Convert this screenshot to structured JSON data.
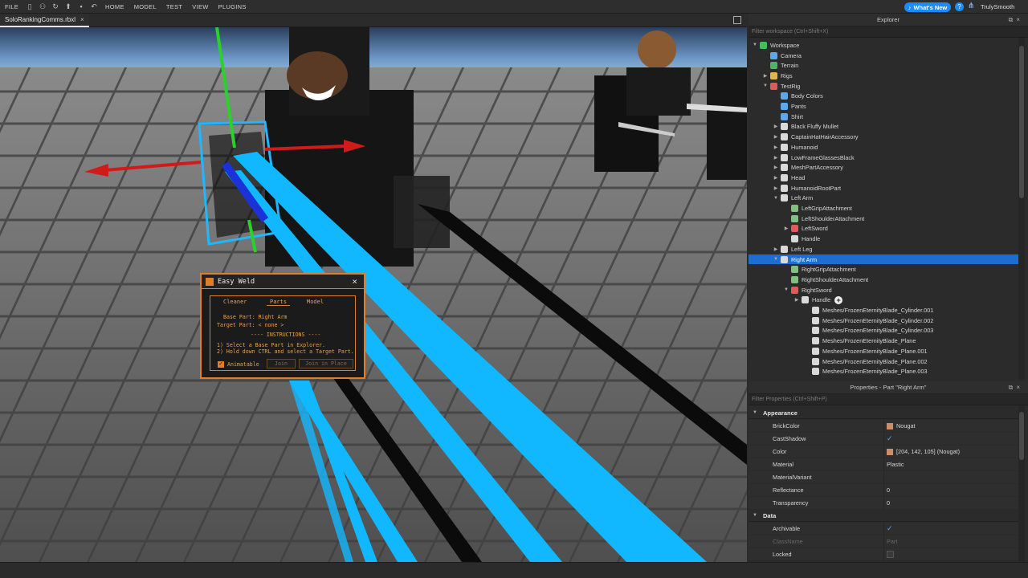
{
  "topbar": {
    "file": "FILE",
    "menus": [
      "HOME",
      "MODEL",
      "TEST",
      "VIEW",
      "PLUGINS"
    ],
    "whats_new": "What's New",
    "username": "TrulySmooth"
  },
  "document_tab": {
    "title": "SoloRankingComms.rbxl",
    "close": "×"
  },
  "explorer": {
    "title": "Explorer",
    "filter_placeholder": "Filter workspace (Ctrl+Shift+X)",
    "rows": [
      {
        "label": "Workspace",
        "depth": 0,
        "caret": "v",
        "icon": "workspace-icon",
        "color": "#3fbf5a"
      },
      {
        "label": "Camera",
        "depth": 1,
        "caret": "",
        "icon": "camera-icon",
        "color": "#5fa8e8"
      },
      {
        "label": "Terrain",
        "depth": 1,
        "caret": "",
        "icon": "terrain-icon",
        "color": "#4bb36a"
      },
      {
        "label": "Rigs",
        "depth": 1,
        "caret": ">",
        "icon": "folder-icon",
        "color": "#e2b64d"
      },
      {
        "label": "TestRig",
        "depth": 1,
        "caret": "v",
        "icon": "model-icon",
        "color": "#e05a5a"
      },
      {
        "label": "Body Colors",
        "depth": 2,
        "caret": "",
        "icon": "body-colors-icon",
        "color": "#5fa8e8"
      },
      {
        "label": "Pants",
        "depth": 2,
        "caret": "",
        "icon": "pants-icon",
        "color": "#5fa8e8"
      },
      {
        "label": "Shirt",
        "depth": 2,
        "caret": "",
        "icon": "shirt-icon",
        "color": "#5fa8e8"
      },
      {
        "label": "Black Fluffy Mullet",
        "depth": 2,
        "caret": ">",
        "icon": "accessory-icon",
        "color": "#d9d9d9"
      },
      {
        "label": "CaptainHatHairAccessory",
        "depth": 2,
        "caret": ">",
        "icon": "accessory-icon",
        "color": "#d9d9d9"
      },
      {
        "label": "Humanoid",
        "depth": 2,
        "caret": ">",
        "icon": "humanoid-icon",
        "color": "#d9d9d9"
      },
      {
        "label": "LowFrameGlassesBlack",
        "depth": 2,
        "caret": ">",
        "icon": "accessory-icon",
        "color": "#d9d9d9"
      },
      {
        "label": "MeshPartAccessory",
        "depth": 2,
        "caret": ">",
        "icon": "accessory-icon",
        "color": "#d9d9d9"
      },
      {
        "label": "Head",
        "depth": 2,
        "caret": ">",
        "icon": "part-icon",
        "color": "#d9d9d9"
      },
      {
        "label": "HumanoidRootPart",
        "depth": 2,
        "caret": ">",
        "icon": "part-icon",
        "color": "#d9d9d9"
      },
      {
        "label": "Left Arm",
        "depth": 2,
        "caret": "v",
        "icon": "part-icon",
        "color": "#d9d9d9"
      },
      {
        "label": "LeftGripAttachment",
        "depth": 3,
        "caret": "",
        "icon": "attachment-icon",
        "color": "#7fbf7f"
      },
      {
        "label": "LeftShoulderAttachment",
        "depth": 3,
        "caret": "",
        "icon": "attachment-icon",
        "color": "#7fbf7f"
      },
      {
        "label": "LeftSword",
        "depth": 3,
        "caret": ">",
        "icon": "model-icon",
        "color": "#e05a5a"
      },
      {
        "label": "Handle",
        "depth": 3,
        "caret": "",
        "icon": "part-icon",
        "color": "#d9d9d9"
      },
      {
        "label": "Left Leg",
        "depth": 2,
        "caret": ">",
        "icon": "part-icon",
        "color": "#d9d9d9"
      },
      {
        "label": "Right Arm",
        "depth": 2,
        "caret": "v",
        "icon": "part-icon",
        "color": "#d9d9d9",
        "selected": true
      },
      {
        "label": "RightGripAttachment",
        "depth": 3,
        "caret": "",
        "icon": "attachment-icon",
        "color": "#7fbf7f"
      },
      {
        "label": "RightShoulderAttachment",
        "depth": 3,
        "caret": "",
        "icon": "attachment-icon",
        "color": "#7fbf7f"
      },
      {
        "label": "RightSword",
        "depth": 3,
        "caret": "v",
        "icon": "model-icon",
        "color": "#e05a5a"
      },
      {
        "label": "Handle",
        "depth": 4,
        "caret": ">",
        "icon": "part-icon",
        "color": "#d9d9d9",
        "hover": true
      },
      {
        "label": "Meshes/FrozenEternityBlade_Cylinder.001",
        "depth": 5,
        "caret": "",
        "icon": "meshpart-icon",
        "color": "#d9d9d9"
      },
      {
        "label": "Meshes/FrozenEternityBlade_Cylinder.002",
        "depth": 5,
        "caret": "",
        "icon": "meshpart-icon",
        "color": "#d9d9d9"
      },
      {
        "label": "Meshes/FrozenEternityBlade_Cylinder.003",
        "depth": 5,
        "caret": "",
        "icon": "meshpart-icon",
        "color": "#d9d9d9"
      },
      {
        "label": "Meshes/FrozenEternityBlade_Plane",
        "depth": 5,
        "caret": "",
        "icon": "meshpart-icon",
        "color": "#d9d9d9"
      },
      {
        "label": "Meshes/FrozenEternityBlade_Plane.001",
        "depth": 5,
        "caret": "",
        "icon": "meshpart-icon",
        "color": "#d9d9d9"
      },
      {
        "label": "Meshes/FrozenEternityBlade_Plane.002",
        "depth": 5,
        "caret": "",
        "icon": "meshpart-icon",
        "color": "#d9d9d9"
      },
      {
        "label": "Meshes/FrozenEternityBlade_Plane.003",
        "depth": 5,
        "caret": "",
        "icon": "meshpart-icon",
        "color": "#d9d9d9"
      }
    ]
  },
  "properties": {
    "title": "Properties - Part \"Right Arm\"",
    "filter_placeholder": "Filter Properties (Ctrl+Shift+P)",
    "sections": [
      {
        "name": "Appearance",
        "rows": [
          {
            "name": "BrickColor",
            "value": "Nougat",
            "swatch": "#cc8e69"
          },
          {
            "name": "CastShadow",
            "checkbox": true
          },
          {
            "name": "Color",
            "value": "[204, 142, 105] (Nougat)",
            "swatch": "#cc8e69"
          },
          {
            "name": "Material",
            "value": "Plastic"
          },
          {
            "name": "MaterialVariant",
            "value": ""
          },
          {
            "name": "Reflectance",
            "value": "0"
          },
          {
            "name": "Transparency",
            "value": "0"
          }
        ]
      },
      {
        "name": "Data",
        "rows": [
          {
            "name": "Archivable",
            "checkbox": true
          },
          {
            "name": "ClassName",
            "value": "Part",
            "dim": true
          },
          {
            "name": "Locked",
            "checkbox": false
          }
        ]
      }
    ]
  },
  "easy_weld": {
    "title": "Easy Weld",
    "close": "×",
    "tabs": [
      "Cleaner",
      "Parts",
      "Model"
    ],
    "base_part": "Base Part: Right Arm",
    "target_part": "Target Part: < none >",
    "instructions_header": "---- INSTRUCTIONS ----",
    "step1": "1) Select a Base Part in Explorer.",
    "step2": "2) Hold down CTRL and select a Target Part.",
    "animatable_label": "Animatable",
    "join_label": "Join",
    "join_in_place_label": "Join in Place",
    "accent": "#e07f27"
  }
}
